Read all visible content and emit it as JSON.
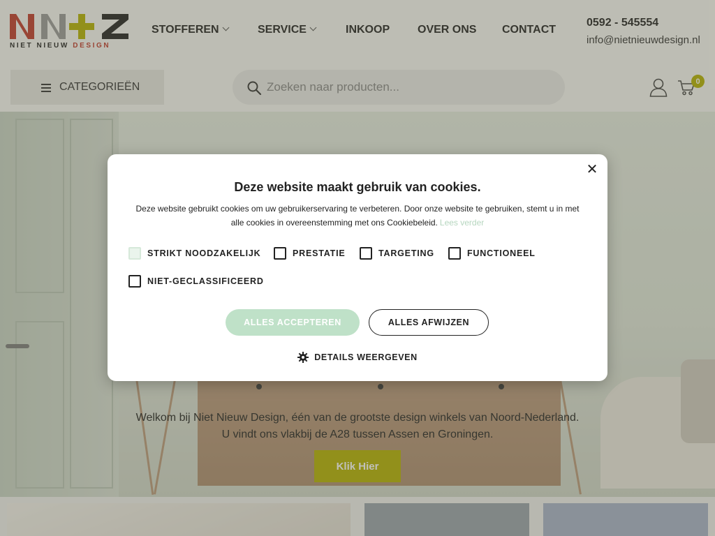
{
  "brand": {
    "logo_text": "NN+Z",
    "tagline_prefix": "NIET NIEUW",
    "tagline_accent": "DESIGN",
    "colors": {
      "red": "#c0392b",
      "grey": "#9a9a9a",
      "olive": "#b5b200",
      "black": "#222222"
    }
  },
  "nav": {
    "items": [
      {
        "label": "STOFFEREN",
        "has_dropdown": true
      },
      {
        "label": "SERVICE",
        "has_dropdown": true
      },
      {
        "label": "INKOOP",
        "has_dropdown": false
      },
      {
        "label": "OVER ONS",
        "has_dropdown": false
      },
      {
        "label": "CONTACT",
        "has_dropdown": false
      }
    ]
  },
  "contact": {
    "phone": "0592 - 545554",
    "email": "info@nietnieuwdesign.nl"
  },
  "toolbar": {
    "categories_label": "CATEGORIEËN",
    "search_placeholder": "Zoeken naar producten...",
    "cart_count": "0",
    "icons": [
      "menu-icon",
      "search-icon",
      "user-icon",
      "cart-icon"
    ]
  },
  "hero": {
    "line1": "Welkom bij Niet Nieuw Design, één van de grootste design winkels van Noord-Nederland.",
    "line2": "U vindt ons vlakbij de A28 tussen Assen en Groningen.",
    "button_label": "Klik Hier"
  },
  "cookie_modal": {
    "title": "Deze website maakt gebruik van cookies.",
    "body": "Deze website gebruikt cookies om uw gebruikerservaring te verbeteren. Door onze website te gebruiken, stemt u in met alle cookies in overeenstemming met ons Cookiebeleid.",
    "read_more": "Lees verder",
    "options": [
      {
        "label": "STRIKT NOODZAKELIJK",
        "checked": true,
        "disabled": true
      },
      {
        "label": "PRESTATIE",
        "checked": false,
        "disabled": false
      },
      {
        "label": "TARGETING",
        "checked": false,
        "disabled": false
      },
      {
        "label": "FUNCTIONEEL",
        "checked": false,
        "disabled": false
      },
      {
        "label": "NIET-GECLASSIFICEERD",
        "checked": false,
        "disabled": false
      }
    ],
    "accept_label": "ALLES ACCEPTEREN",
    "reject_label": "ALLES AFWIJZEN",
    "details_label": "DETAILS WEERGEVEN",
    "close_glyph": "✕"
  }
}
